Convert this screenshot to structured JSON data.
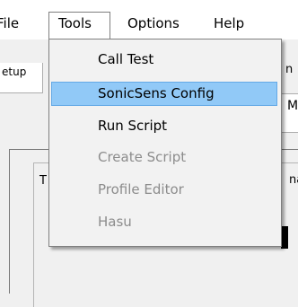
{
  "menubar": {
    "file": "File",
    "tools": "Tools",
    "options": "Options",
    "help": "Help"
  },
  "background": {
    "setup_tab": "etup",
    "fragment_n": "n",
    "fragment_m": "M",
    "fragment_t": "T",
    "fragment_na": "na"
  },
  "tools_menu": {
    "items": [
      {
        "label": "Call Test",
        "enabled": true,
        "highlighted": false
      },
      {
        "label": "SonicSens Config",
        "enabled": true,
        "highlighted": true
      },
      {
        "label": "Run Script",
        "enabled": true,
        "highlighted": false
      },
      {
        "label": "Create Script",
        "enabled": false,
        "highlighted": false
      },
      {
        "label": "Profile Editor",
        "enabled": false,
        "highlighted": false
      },
      {
        "label": "Hasu",
        "enabled": false,
        "highlighted": false
      }
    ]
  },
  "colors": {
    "highlight_bg": "#91c9f7",
    "highlight_border": "#64a9e6",
    "disabled_text": "#8c8c8c",
    "menu_bg": "#f2f2f2"
  }
}
